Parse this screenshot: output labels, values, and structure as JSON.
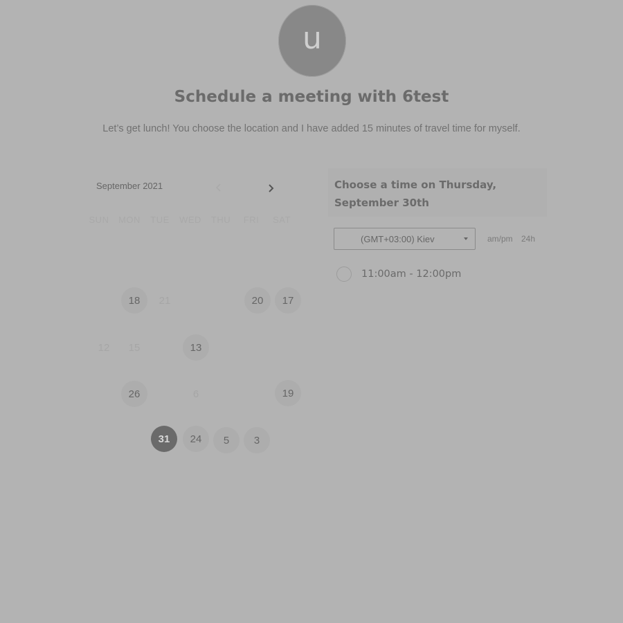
{
  "header": {
    "avatar_letter": "u",
    "title": "Schedule a meeting with 6test",
    "description": "Let’s get lunch! You choose the location and I have added 15 minutes of travel time for myself."
  },
  "calendar": {
    "month_label": "September 2021",
    "prev_icon": "chevron-left-icon",
    "next_icon": "chevron-right-icon",
    "weekdays": [
      "SUN",
      "MON",
      "TUE",
      "WED",
      "THU",
      "FRI",
      "SAT"
    ],
    "days": {
      "d18": "18",
      "d21": "21",
      "d20": "20",
      "d17": "17",
      "d12": "12",
      "d15": "15",
      "d13": "13",
      "d26": "26",
      "d6": "6",
      "d19": "19",
      "d31": "31",
      "d24": "24",
      "d5": "5",
      "d3": "3"
    },
    "selected_day": "31"
  },
  "time_panel": {
    "heading_line1": "Choose a time on Thursday,",
    "heading_line2": "September 30th",
    "timezone": "(GMT+03:00) Kiev",
    "format_ampm": "am/pm",
    "format_24h": "24h",
    "slots": [
      {
        "label": "11:00am - 12:00pm"
      }
    ]
  },
  "colors": {
    "background": "#b3b3b3",
    "selected_day": "#6a6a6a",
    "available_day": "#adadad",
    "avatar": "#888888"
  }
}
